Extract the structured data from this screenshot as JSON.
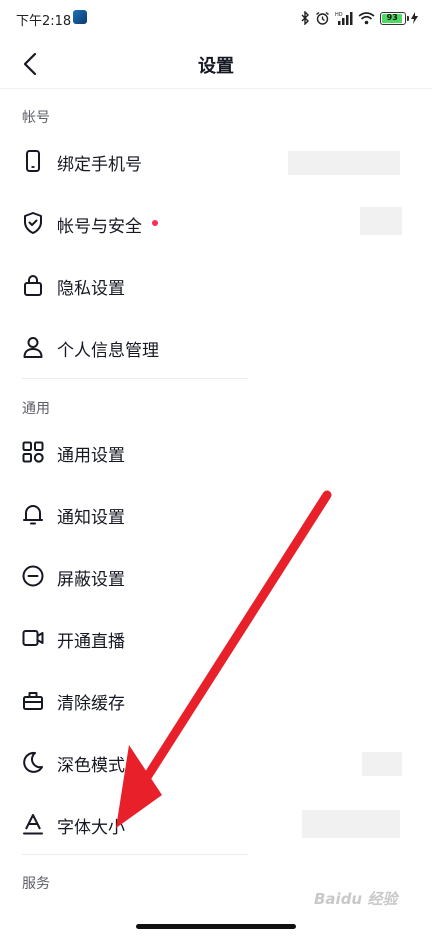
{
  "status_bar": {
    "time": "下午2:18",
    "battery": "93"
  },
  "nav": {
    "title": "设置"
  },
  "sections": {
    "account": "帐号",
    "general": "通用",
    "services": "服务"
  },
  "items": {
    "bind_phone": "绑定手机号",
    "account_security": "帐号与安全",
    "privacy": "隐私设置",
    "personal_info": "个人信息管理",
    "general_settings": "通用设置",
    "notification": "通知设置",
    "block": "屏蔽设置",
    "live": "开通直播",
    "clear_cache": "清除缓存",
    "dark_mode": "深色模式",
    "font_size": "字体大小"
  },
  "watermark": "Baidu 经验",
  "colors": {
    "accent_red": "#fe2c55",
    "arrow_red": "#e8202a"
  }
}
